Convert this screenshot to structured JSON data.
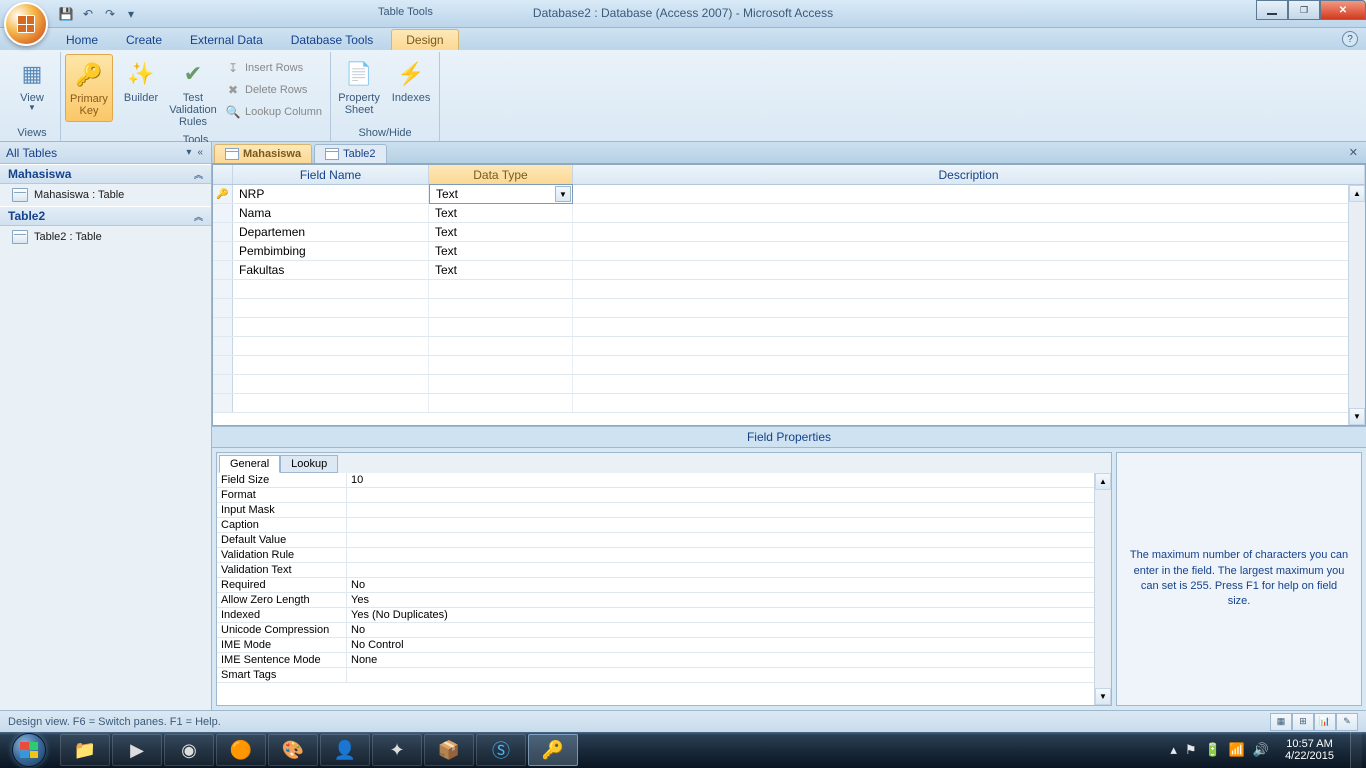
{
  "title": {
    "context_label": "Table Tools",
    "text": "Database2 : Database (Access 2007)  -  Microsoft Access"
  },
  "tabs": {
    "home": "Home",
    "create": "Create",
    "external": "External Data",
    "dbtools": "Database Tools",
    "design": "Design"
  },
  "ribbon": {
    "views": {
      "label": "Views",
      "view": "View"
    },
    "tools": {
      "label": "Tools",
      "primary_key": "Primary Key",
      "builder": "Builder",
      "test_validation": "Test Validation Rules",
      "insert_rows": "Insert Rows",
      "delete_rows": "Delete Rows",
      "lookup_column": "Lookup Column"
    },
    "showhide": {
      "label": "Show/Hide",
      "property_sheet": "Property Sheet",
      "indexes": "Indexes"
    }
  },
  "nav": {
    "header": "All Tables",
    "groups": [
      {
        "name": "Mahasiswa",
        "items": [
          "Mahasiswa : Table"
        ]
      },
      {
        "name": "Table2",
        "items": [
          "Table2 : Table"
        ]
      }
    ]
  },
  "doc_tabs": {
    "t1": "Mahasiswa",
    "t2": "Table2"
  },
  "grid": {
    "headers": {
      "fn": "Field Name",
      "dt": "Data Type",
      "desc": "Description"
    },
    "rows": [
      {
        "pk": true,
        "field": "NRP",
        "type": "Text",
        "desc": ""
      },
      {
        "pk": false,
        "field": "Nama",
        "type": "Text",
        "desc": ""
      },
      {
        "pk": false,
        "field": "Departemen",
        "type": "Text",
        "desc": ""
      },
      {
        "pk": false,
        "field": "Pembimbing",
        "type": "Text",
        "desc": ""
      },
      {
        "pk": false,
        "field": "Fakultas",
        "type": "Text",
        "desc": ""
      }
    ]
  },
  "fp": {
    "header": "Field Properties",
    "tabs": {
      "general": "General",
      "lookup": "Lookup"
    },
    "rows": [
      {
        "label": "Field Size",
        "value": "10"
      },
      {
        "label": "Format",
        "value": ""
      },
      {
        "label": "Input Mask",
        "value": ""
      },
      {
        "label": "Caption",
        "value": ""
      },
      {
        "label": "Default Value",
        "value": ""
      },
      {
        "label": "Validation Rule",
        "value": ""
      },
      {
        "label": "Validation Text",
        "value": ""
      },
      {
        "label": "Required",
        "value": "No"
      },
      {
        "label": "Allow Zero Length",
        "value": "Yes"
      },
      {
        "label": "Indexed",
        "value": "Yes (No Duplicates)"
      },
      {
        "label": "Unicode Compression",
        "value": "No"
      },
      {
        "label": "IME Mode",
        "value": "No Control"
      },
      {
        "label": "IME Sentence Mode",
        "value": "None"
      },
      {
        "label": "Smart Tags",
        "value": ""
      }
    ],
    "hint": "The maximum number of characters you can enter in the field.  The largest maximum you can set is 255.  Press F1 for help on field size."
  },
  "status": {
    "text": "Design view.   F6 = Switch panes.   F1 = Help."
  },
  "tray": {
    "time": "10:57 AM",
    "date": "4/22/2015"
  }
}
